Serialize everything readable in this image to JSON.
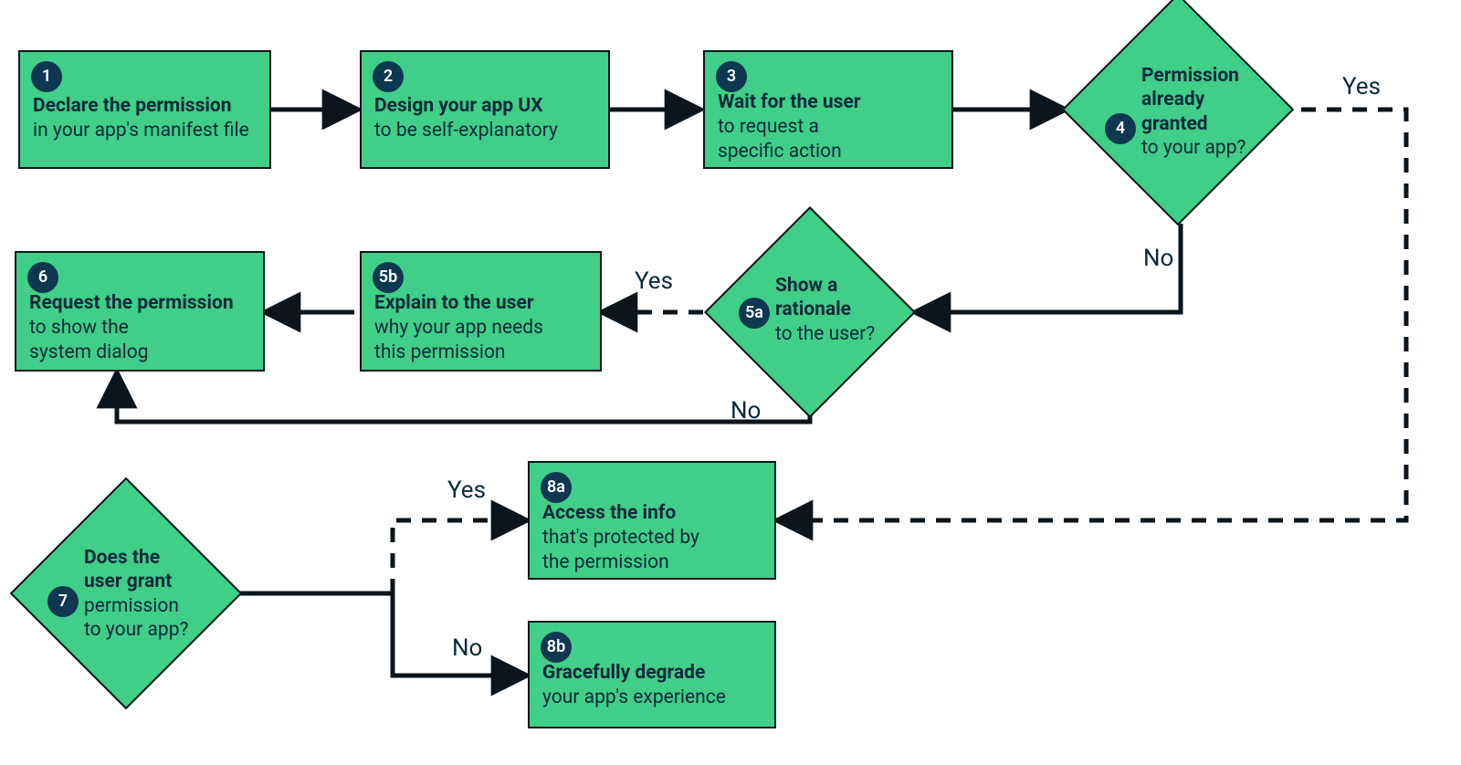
{
  "colors": {
    "fill": "#40ce88",
    "stroke": "#0b151b",
    "badge": "#0d3850",
    "text": "#0a2a3a"
  },
  "nodes": {
    "n1": {
      "num": "1",
      "title": "Declare the permission",
      "sub": "in your app's manifest file"
    },
    "n2": {
      "num": "2",
      "title": "Design your app UX",
      "sub": "to be self-explanatory"
    },
    "n3": {
      "num": "3",
      "title": "Wait for the user",
      "sub": "to request a\nspecific action"
    },
    "n4": {
      "num": "4",
      "title": "Permission\nalready\ngranted",
      "sub": "to your app?"
    },
    "n5a": {
      "num": "5a",
      "title": "Show a\nrationale",
      "sub": "to the user?"
    },
    "n5b": {
      "num": "5b",
      "title": "Explain to the user",
      "sub": "why your app needs\nthis permission"
    },
    "n6": {
      "num": "6",
      "title": "Request the permission",
      "sub": "to show the\nsystem dialog"
    },
    "n7": {
      "num": "7",
      "title": "Does the\nuser grant",
      "sub": "permission\nto your app?"
    },
    "n8a": {
      "num": "8a",
      "title": "Access the info",
      "sub": "that's protected by\nthe permission"
    },
    "n8b": {
      "num": "8b",
      "title": "Gracefully degrade",
      "sub": "your app's experience"
    }
  },
  "edges": {
    "e4_yes": {
      "label": "Yes"
    },
    "e4_no": {
      "label": "No"
    },
    "e5a_yes": {
      "label": "Yes"
    },
    "e5a_no": {
      "label": "No"
    },
    "e7_yes": {
      "label": "Yes"
    },
    "e7_no": {
      "label": "No"
    }
  }
}
